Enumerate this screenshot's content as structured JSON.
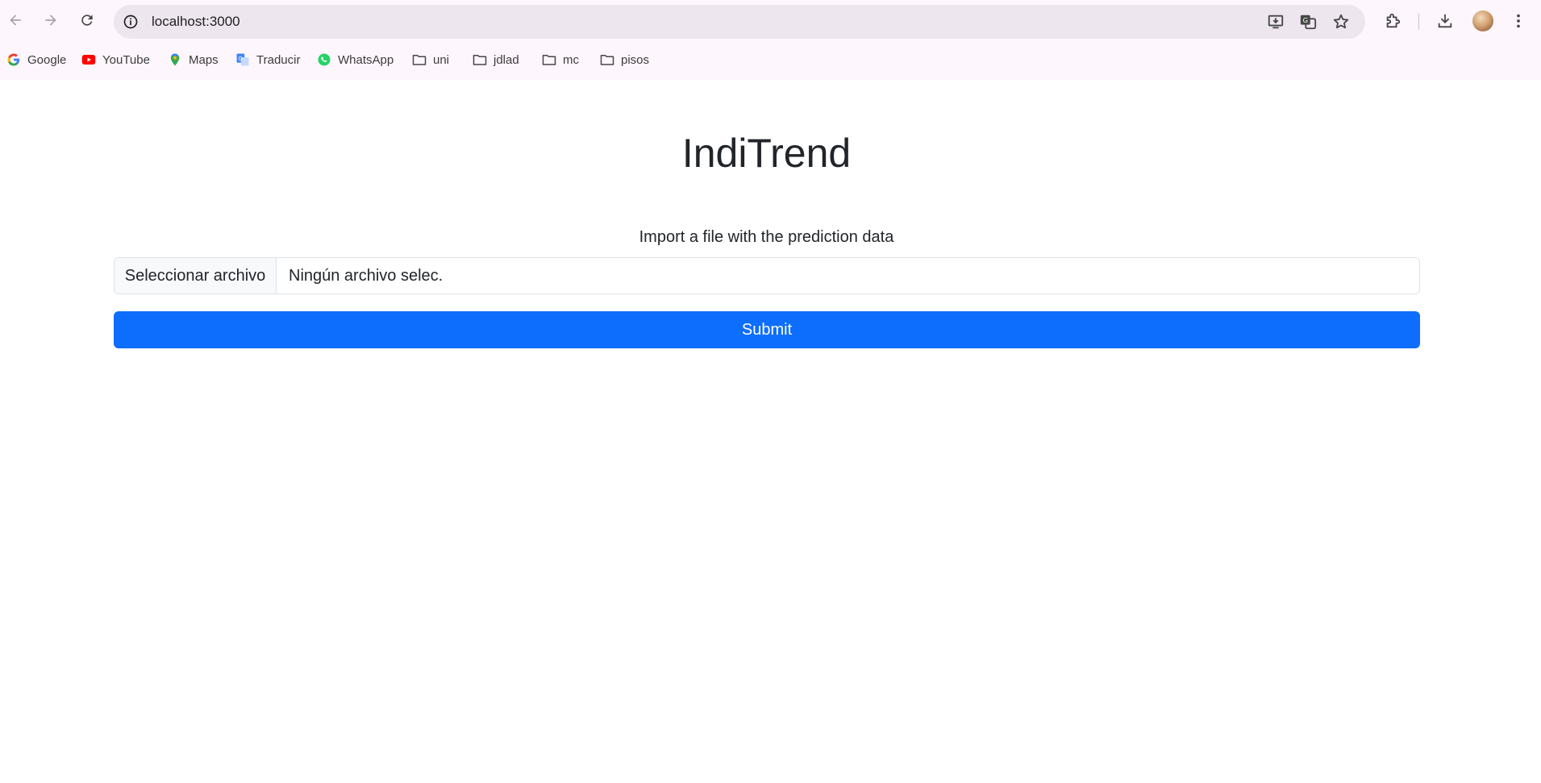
{
  "browser": {
    "url": "localhost:3000",
    "bookmarks": [
      {
        "label": "Google",
        "icon": "google-icon"
      },
      {
        "label": "YouTube",
        "icon": "youtube-icon"
      },
      {
        "label": "Maps",
        "icon": "maps-icon"
      },
      {
        "label": "Traducir",
        "icon": "translate-icon"
      },
      {
        "label": "WhatsApp",
        "icon": "whatsapp-icon"
      },
      {
        "label": "uni",
        "icon": "folder-icon"
      },
      {
        "label": "jdlad",
        "icon": "folder-icon"
      },
      {
        "label": "mc",
        "icon": "folder-icon"
      },
      {
        "label": "pisos",
        "icon": "folder-icon"
      }
    ],
    "colors": {
      "chrome_bg": "#fdf6fc",
      "omnibox_bg": "#ede6ef"
    }
  },
  "app": {
    "title": "IndiTrend",
    "subtitle": "Import a file with the prediction data",
    "file_button_label": "Seleccionar archivo",
    "file_status": "Ningún archivo selec.",
    "submit_label": "Submit",
    "colors": {
      "primary": "#0d6efd",
      "text": "#212529"
    }
  }
}
